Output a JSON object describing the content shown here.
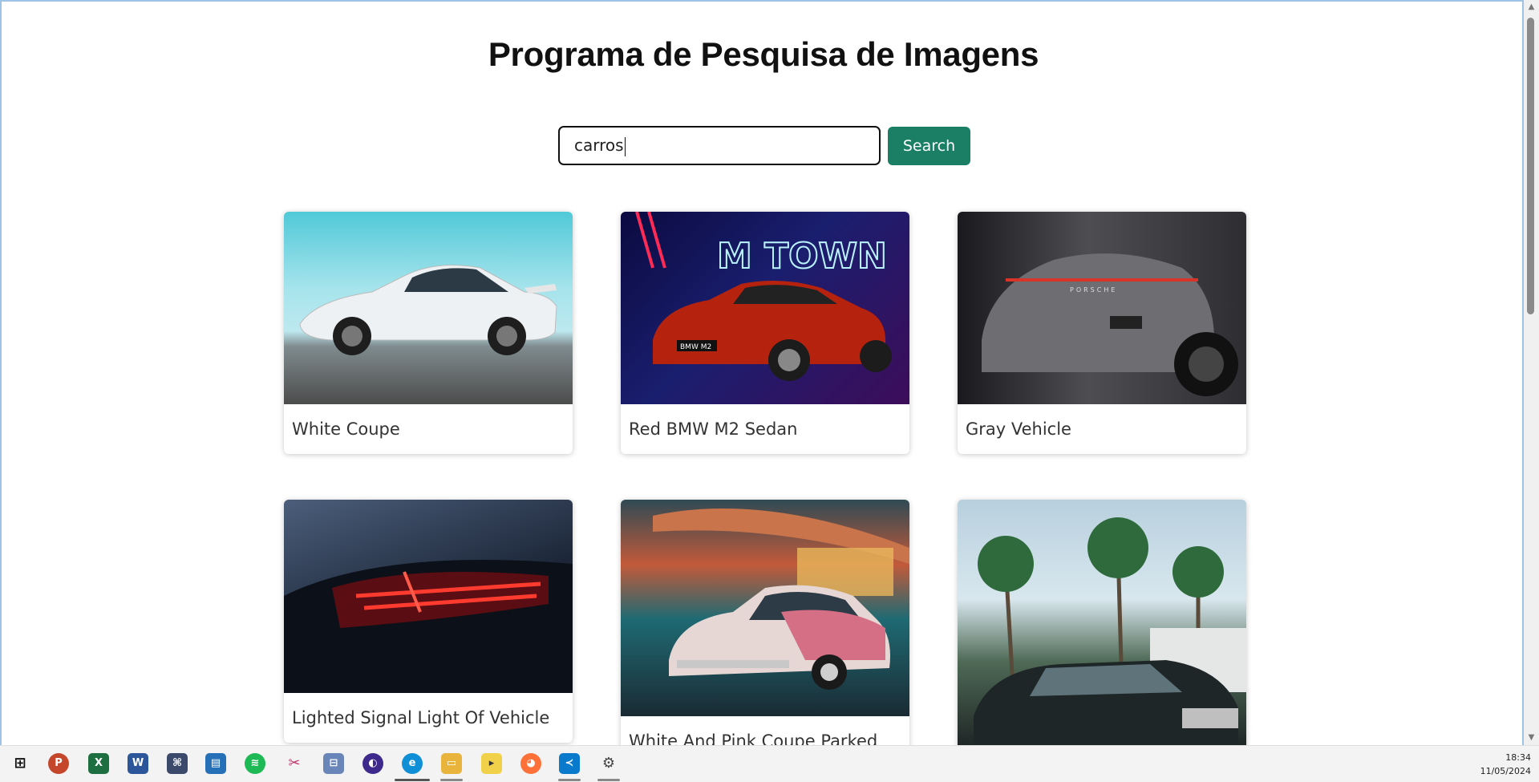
{
  "page": {
    "title": "Programa de Pesquisa de Imagens",
    "search": {
      "value": "carros",
      "button_label": "Search"
    }
  },
  "results": [
    {
      "caption": "White Coupe"
    },
    {
      "caption": "Red BMW M2 Sedan"
    },
    {
      "caption": "Gray Vehicle"
    },
    {
      "caption": "Lighted Signal Light Of Vehicle"
    },
    {
      "caption": "White And Pink Coupe Parked"
    },
    {
      "caption": ""
    }
  ],
  "image_text": {
    "neon_sign": "M TOWN",
    "plate": "BMW M2",
    "porsche_badge": "PORSCHE"
  },
  "colors": {
    "accent": "#1a7f64",
    "window_border": "#9fc3e6"
  },
  "taskbar": {
    "apps": [
      "windows-start-icon",
      "powerpoint-icon",
      "excel-icon",
      "word-icon",
      "sql-tool-icon",
      "store-icon",
      "spotify-icon",
      "snipping-tool-icon",
      "network-tool-icon",
      "app-icon",
      "edge-icon",
      "file-explorer-icon",
      "sticky-notes-icon",
      "firefox-icon",
      "vscode-icon",
      "settings-icon"
    ],
    "time": "18:34",
    "date": "11/05/2024"
  }
}
